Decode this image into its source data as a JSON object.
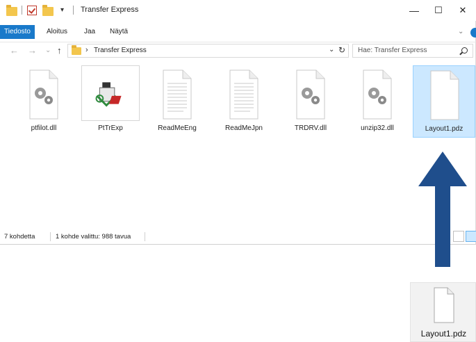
{
  "window": {
    "title": "Transfer Express",
    "buttons": {
      "minimize": "—",
      "maximize": "☐",
      "close": "✕"
    }
  },
  "ribbon": {
    "tabs": [
      "Tiedosto",
      "Aloitus",
      "Jaa",
      "Näytä"
    ],
    "expand_chevron": "⌄"
  },
  "address": {
    "back": "←",
    "forward": "→",
    "recent": "⌄",
    "up": "↑",
    "path_chevron": "›",
    "path": "Transfer Express",
    "dropdown": "⌄",
    "refresh": "↻"
  },
  "search": {
    "placeholder": "Hae: Transfer Express"
  },
  "files": [
    {
      "name": "ptfilot.dll",
      "icon": "dll-gear-icon"
    },
    {
      "name": "PtTrExp",
      "icon": "application-icon"
    },
    {
      "name": "ReadMeEng",
      "icon": "text-document-icon"
    },
    {
      "name": "ReadMeJpn",
      "icon": "text-document-icon"
    },
    {
      "name": "TRDRV.dll",
      "icon": "dll-gear-icon"
    },
    {
      "name": "unzip32.dll",
      "icon": "dll-gear-icon"
    },
    {
      "name": "Layout1.pdz",
      "icon": "blank-document-icon",
      "selected": true
    }
  ],
  "status": {
    "count": "7 kohdetta",
    "selection": "1 kohde valittu: 988 tavua"
  },
  "drag": {
    "name": "Layout1.pdz"
  },
  "colors": {
    "accent": "#1979ca",
    "arrow": "#1f4e8c",
    "selection": "#cce8ff"
  }
}
